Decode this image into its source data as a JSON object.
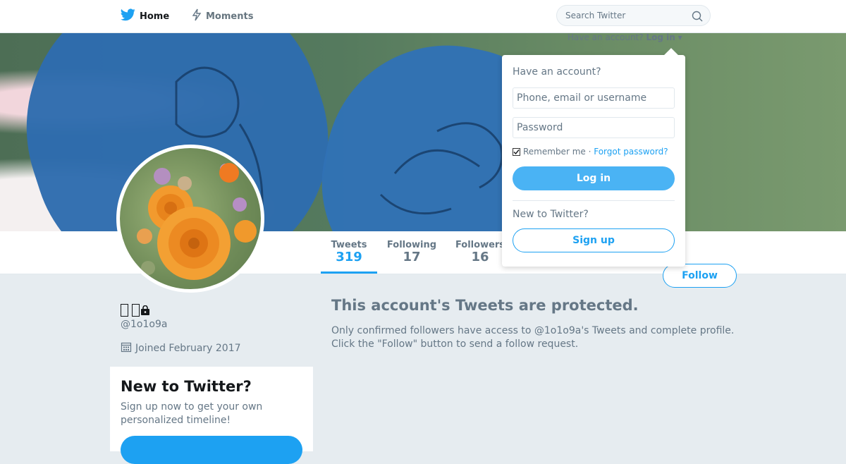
{
  "nav": {
    "home_label": "Home",
    "moments_label": "Moments",
    "search_placeholder": "Search Twitter"
  },
  "banner": {
    "login_hint": "Have an account?",
    "login_link": "Log in"
  },
  "profile": {
    "name": "",
    "handle": "@1o1o9a",
    "joined": "Joined February 2017"
  },
  "stats": [
    {
      "label": "Tweets",
      "value": "319"
    },
    {
      "label": "Following",
      "value": "17"
    },
    {
      "label": "Followers",
      "value": "16"
    }
  ],
  "follow_label": "Follow",
  "protected": {
    "title": "This account's Tweets are protected.",
    "desc": "Only confirmed followers have access to @1o1o9a's Tweets and complete profile. Click the \"Follow\" button to send a follow request."
  },
  "signup_card": {
    "title": "New to Twitter?",
    "desc": "Sign up now to get your own personalized timeline!"
  },
  "login_dropdown": {
    "title": "Have an account?",
    "username_placeholder": "Phone, email or username",
    "password_placeholder": "Password",
    "remember_label": "Remember me",
    "separator": " · ",
    "forgot_label": "Forgot password?",
    "login_button": "Log in",
    "new_label": "New to Twitter?",
    "signup_button": "Sign up"
  },
  "colors": {
    "accent": "#1da1f2",
    "background": "#e6ecf0",
    "muted_text": "#657786"
  }
}
